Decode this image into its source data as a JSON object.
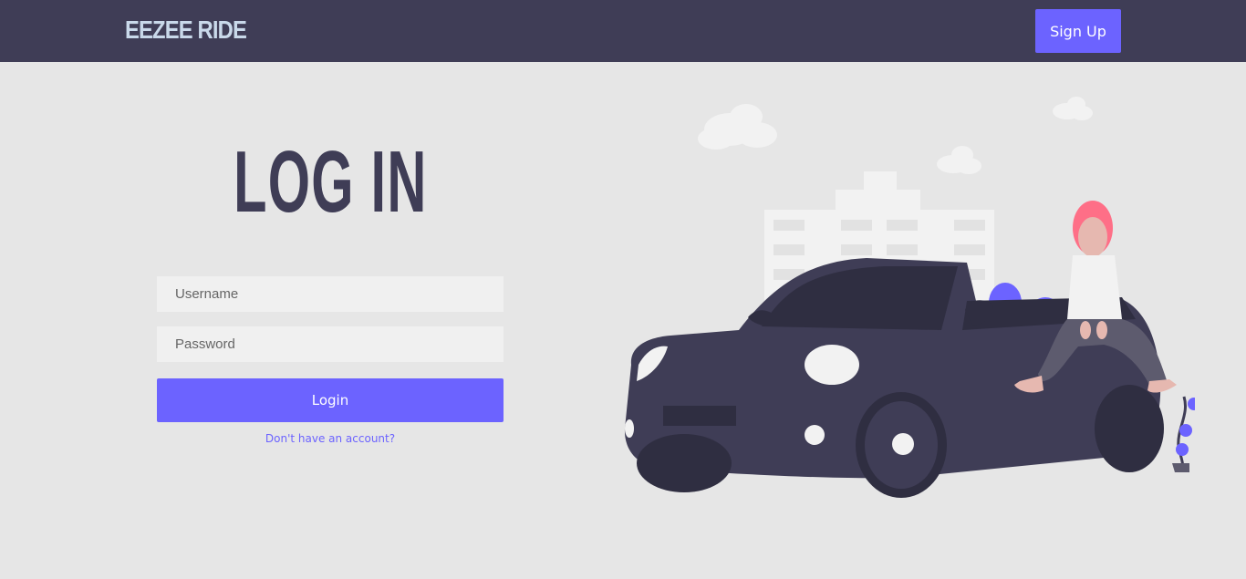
{
  "navbar": {
    "brand": "EEZEE RIDE",
    "signup_label": "Sign Up"
  },
  "login": {
    "title": "LOG IN",
    "username_placeholder": "Username",
    "password_placeholder": "Password",
    "submit_label": "Login",
    "account_link": "Don't have an account?"
  },
  "colors": {
    "navbar_bg": "#3f3d56",
    "accent": "#6c63ff",
    "page_bg": "#e6e6e6",
    "brand_text": "#c9d9ea"
  },
  "illustration": {
    "icon": "woman-sitting-on-convertible-car-illustration"
  }
}
